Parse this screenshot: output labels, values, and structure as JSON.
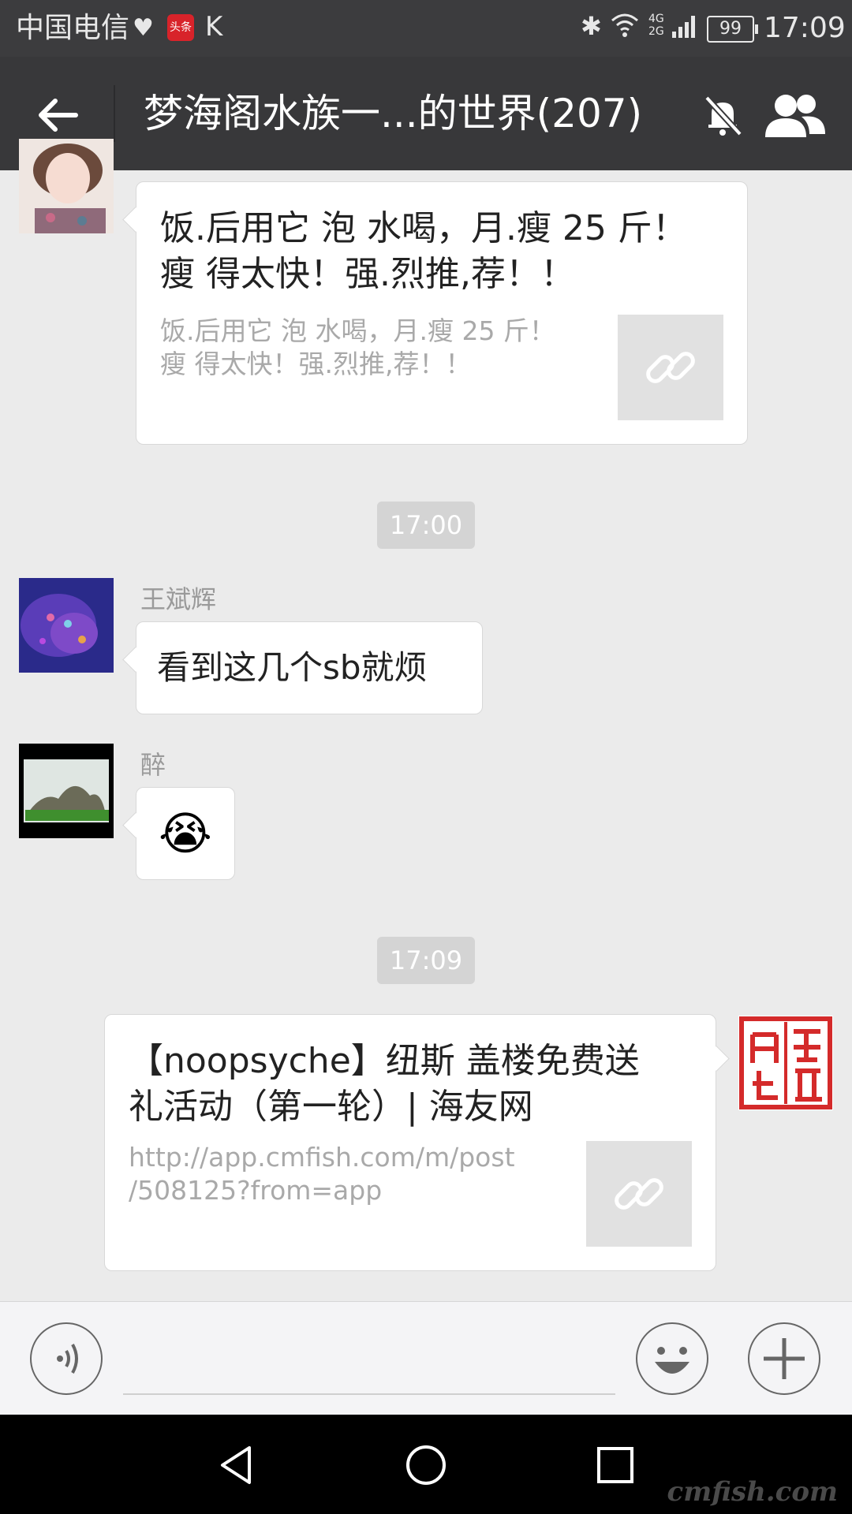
{
  "status_bar": {
    "carrier": "中国电信",
    "news_badge": "头条",
    "k_glyph": "K",
    "network_top": "4G",
    "network_bottom": "2G",
    "battery": "99",
    "time": "17:09"
  },
  "title_bar": {
    "title": "梦海阁水族一...的世界(207)",
    "icons": [
      "back-arrow-icon",
      "mute-bell-icon",
      "group-members-icon"
    ]
  },
  "messages": [
    {
      "type": "link",
      "side": "left",
      "title_line1": "饭.后用它 泡 水喝，月.瘦 25 斤！",
      "title_line2": "瘦 得太快！强.烈推,荐！！",
      "desc_line1": "饭.后用它 泡 水喝，月.瘦 25 斤！",
      "desc_line2": "瘦 得太快！强.烈推,荐！！"
    },
    {
      "type": "timestamp",
      "text": "17:00"
    },
    {
      "type": "text",
      "side": "left",
      "sender": "王斌辉",
      "text": "看到这几个sb就烦"
    },
    {
      "type": "emoji",
      "side": "left",
      "sender": "醉",
      "emoji": "😭"
    },
    {
      "type": "timestamp",
      "text": "17:09"
    },
    {
      "type": "link",
      "side": "right",
      "title_line1": "【noopsyche】纽斯 盖楼免费送",
      "title_line2": "礼活动（第一轮）| 海友网",
      "desc_line1": "http://app.cmfish.com/m/post",
      "desc_line2": "/508125?from=app"
    }
  ],
  "input_bar": {
    "icons": [
      "voice-icon",
      "emoji-icon",
      "plus-icon"
    ]
  },
  "watermark": "cmfish.com",
  "colors": {
    "status_bg": "#3c3c3e",
    "title_bg": "#38383a",
    "chat_bg": "#ebebeb",
    "timestamp_bg": "#d4d4d4",
    "seal_red": "#d42a2a"
  }
}
